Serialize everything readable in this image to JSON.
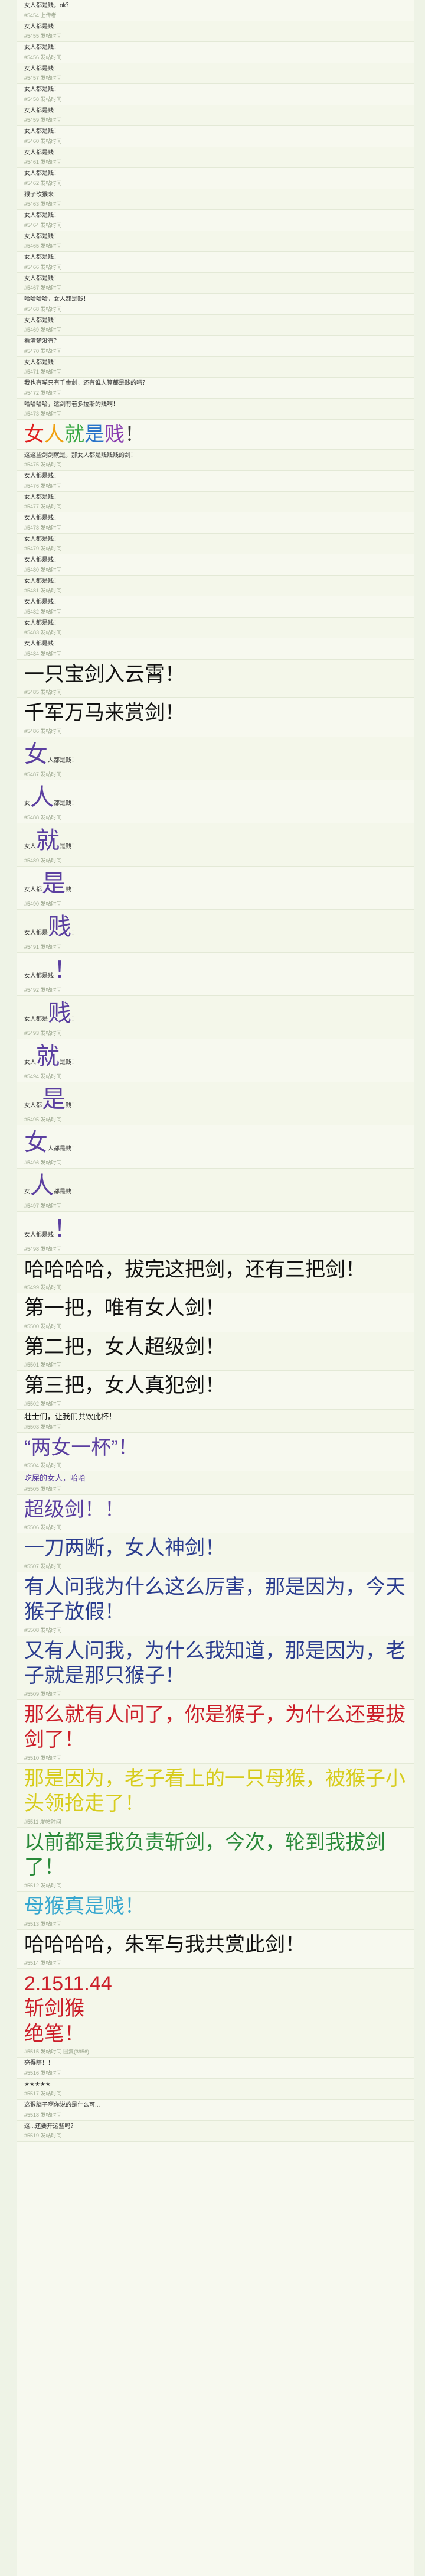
{
  "posts": [
    {
      "text": "女人都是贱，ok？",
      "size": "s1",
      "color": "",
      "meta": "#5454 上传者"
    },
    {
      "text": "女人都是贱！",
      "size": "s1",
      "color": "",
      "meta": "#5455 发帖时间"
    },
    {
      "text": "女人都是贱！",
      "size": "s1",
      "color": "",
      "meta": "#5456 发帖时间"
    },
    {
      "text": "女人都是贱！",
      "size": "s1",
      "color": "",
      "meta": "#5457 发帖时间"
    },
    {
      "text": "女人都是贱！",
      "size": "s1",
      "color": "",
      "meta": "#5458 发帖时间"
    },
    {
      "text": "女人都是贱！",
      "size": "s1",
      "color": "",
      "meta": "#5459 发帖时间"
    },
    {
      "text": "女人都是贱！",
      "size": "s1",
      "color": "",
      "meta": "#5460 发帖时间"
    },
    {
      "text": "女人都是贱！",
      "size": "s1",
      "color": "",
      "meta": "#5461 发帖时间"
    },
    {
      "text": "女人都是贱！",
      "size": "s1",
      "color": "",
      "meta": "#5462 发帖时间"
    },
    {
      "text": "猴子砍猴来！",
      "size": "s1",
      "color": "",
      "meta": "#5463 发帖时间"
    },
    {
      "text": "女人都是贱！",
      "size": "s1",
      "color": "",
      "meta": "#5464 发帖时间"
    },
    {
      "text": "女人都是贱！",
      "size": "s1",
      "color": "",
      "meta": "#5465 发帖时间"
    },
    {
      "text": "女人都是贱！",
      "size": "s1",
      "color": "",
      "meta": "#5466 发帖时间"
    },
    {
      "text": "女人都是贱！",
      "size": "s1",
      "color": "",
      "meta": "#5467 发帖时间"
    },
    {
      "text": "哈哈哈哈，女人都是贱！",
      "size": "s1",
      "color": "",
      "meta": "#5468 发帖时间"
    },
    {
      "text": "女人都是贱！",
      "size": "s1",
      "color": "",
      "meta": "#5469 发帖时间"
    },
    {
      "text": "看清楚没有？",
      "size": "s1",
      "color": "",
      "meta": "#5470 发帖时间"
    },
    {
      "text": "女人都是贱！",
      "size": "s1",
      "color": "",
      "meta": "#5471 发帖时间"
    },
    {
      "text": "我也有嘴只有千金剑，还有谁人算都是贱的吗？",
      "size": "s1",
      "color": "",
      "meta": "#5472 发帖时间"
    },
    {
      "text": "哈哈哈哈，这剑有着多拉斯的贱啊！",
      "size": "s1",
      "color": "",
      "meta": "#5473 发帖时间"
    },
    {
      "text": "女人就是贱！",
      "size": "big",
      "color": "rainbow",
      "meta": ""
    },
    {
      "text": "这这些剑剑就是，那女人都是贱贱贱的剑！",
      "size": "s1",
      "color": "",
      "meta": "#5475 发帖时间"
    },
    {
      "text": "女人都是贱！",
      "size": "s1",
      "color": "",
      "meta": "#5476 发帖时间"
    },
    {
      "text": "女人都是贱！",
      "size": "s1",
      "color": "",
      "meta": "#5477 发帖时间"
    },
    {
      "text": "女人都是贱！",
      "size": "s1",
      "color": "",
      "meta": "#5478 发帖时间"
    },
    {
      "text": "女人都是贱！",
      "size": "s1",
      "color": "",
      "meta": "#5479 发帖时间"
    },
    {
      "text": "女人都是贱！",
      "size": "s1",
      "color": "",
      "meta": "#5480 发帖时间"
    },
    {
      "text": "女人都是贱！",
      "size": "s1",
      "color": "",
      "meta": "#5481 发帖时间"
    },
    {
      "text": "女人都是贱！",
      "size": "s1",
      "color": "",
      "meta": "#5482 发帖时间"
    },
    {
      "text": "女人都是贱！",
      "size": "s1",
      "color": "",
      "meta": "#5483 发帖时间"
    },
    {
      "text": "女人都是贱！",
      "size": "s1",
      "color": "",
      "meta": "#5484 发帖时间"
    },
    {
      "text": "一只宝剑入云霄！",
      "size": "big",
      "color": "c-dark",
      "meta": "#5485 发帖时间"
    },
    {
      "text": "千军万马来赏剑！",
      "size": "big",
      "color": "c-dark",
      "meta": "#5486 发帖时间"
    },
    {
      "text": "女",
      "size": "huge",
      "color": "c-purple",
      "suffix": "人都是贱！",
      "meta": "#5487 发帖时间"
    },
    {
      "text": "人",
      "size": "huge",
      "color": "c-purple",
      "prefix": "女",
      "suffix": "都是贱！",
      "meta": "#5488 发帖时间"
    },
    {
      "text": "就",
      "size": "huge",
      "color": "c-purple",
      "prefix": "女人",
      "suffix": "是贱！",
      "meta": "#5489 发帖时间"
    },
    {
      "text": "是",
      "size": "huge",
      "color": "c-purple",
      "prefix": "女人都",
      "suffix": "贱！",
      "meta": "#5490 发帖时间"
    },
    {
      "text": "贱",
      "size": "huge",
      "color": "c-purple",
      "prefix": "女人都是",
      "suffix": "！",
      "meta": "#5491 发帖时间"
    },
    {
      "text": "！",
      "size": "huge",
      "color": "c-purple",
      "prefix": "女人都是贱",
      "suffix": "",
      "meta": "#5492 发帖时间"
    },
    {
      "text": "贱",
      "size": "huge",
      "color": "c-purple",
      "prefix": "女人都是",
      "suffix": "！",
      "meta": "#5493 发帖时间"
    },
    {
      "text": "就",
      "size": "huge",
      "color": "c-purple",
      "prefix": "女人",
      "suffix": "是贱！",
      "meta": "#5494 发帖时间"
    },
    {
      "text": "是",
      "size": "huge",
      "color": "c-purple",
      "prefix": "女人都",
      "suffix": "贱！",
      "meta": "#5495 发帖时间"
    },
    {
      "text": "女",
      "size": "huge",
      "color": "c-purple",
      "suffix": "人都是贱！",
      "meta": "#5496 发帖时间"
    },
    {
      "text": "人",
      "size": "huge",
      "color": "c-purple",
      "prefix": "女",
      "suffix": "都是贱！",
      "meta": "#5497 发帖时间"
    },
    {
      "text": "！",
      "size": "huge",
      "color": "c-purple",
      "prefix": "女人都是贱",
      "suffix": "",
      "meta": "#5498 发帖时间"
    },
    {
      "text": "哈哈哈哈，拔完这把剑，还有三把剑！",
      "size": "big",
      "color": "c-dark",
      "meta": "#5499 发帖时间"
    },
    {
      "text": "第一把，唯有女人剑！",
      "size": "big",
      "color": "c-dark",
      "meta": "#5500 发帖时间"
    },
    {
      "text": "第二把，女人超级剑！",
      "size": "big",
      "color": "c-dark",
      "meta": "#5501 发帖时间"
    },
    {
      "text": "第三把，女人真犯剑！",
      "size": "big",
      "color": "c-dark",
      "meta": "#5502 发帖时间"
    },
    {
      "text": "壮士们，让我们共饮此杯！",
      "size": "s2",
      "color": "c-dark",
      "meta": "#5503 发帖时间"
    },
    {
      "text": "“两女一杯”！",
      "size": "big",
      "color": "c-purple",
      "meta": "#5504 发帖时间"
    },
    {
      "text": "吃屎的女人，哈哈",
      "size": "s2",
      "color": "c-purple",
      "meta": "#5505 发帖时间"
    },
    {
      "text": "超级剑！！",
      "size": "big",
      "color": "c-purple",
      "meta": "#5506 发帖时间"
    },
    {
      "text": "一刀两断，女人神剑！",
      "size": "big",
      "color": "c-navy",
      "meta": "#5507 发帖时间"
    },
    {
      "text": "有人问我为什么这么厉害，那是因为，今天猴子放假！",
      "size": "big",
      "color": "c-navy",
      "meta": "#5508 发帖时间"
    },
    {
      "text": "又有人问我，为什么我知道，那是因为，老子就是那只猴子！",
      "size": "big",
      "color": "c-navy",
      "meta": "#5509 发帖时间"
    },
    {
      "text": "那么就有人问了，你是猴子，为什么还要拔剑了！",
      "size": "big",
      "color": "c-red",
      "meta": "#5510 发帖时间"
    },
    {
      "text": "那是因为，老子看上的一只母猴，被猴子小头领抢走了！",
      "size": "big",
      "color": "c-yellow",
      "meta": "#5511 发帖时间"
    },
    {
      "text": "以前都是我负责斩剑，今次，轮到我拔剑了！",
      "size": "big",
      "color": "c-green",
      "meta": "#5512 发帖时间"
    },
    {
      "text": "母猴真是贱！",
      "size": "big",
      "color": "c-cyan",
      "meta": "#5513 发帖时间"
    },
    {
      "text": "哈哈哈哈，朱军与我共赏此剑！",
      "size": "big",
      "color": "c-dark",
      "meta": "#5514 发帖时间"
    },
    {
      "text": "2.1511.44\n斩剑猴\n绝笔！",
      "size": "big",
      "color": "c-red",
      "meta": "#5515 发帖时间 回复(3956)"
    },
    {
      "text": "亮得瞎！！",
      "size": "s1",
      "color": "",
      "meta": "#5516 发帖时间"
    },
    {
      "text": "★★★★★",
      "size": "s1",
      "color": "",
      "meta": "#5517 发帖时间"
    },
    {
      "text": "这猴脑子啊你说的是什么可...",
      "size": "s1",
      "color": "",
      "meta": "#5518 发帖时间"
    },
    {
      "text": "这...还要开这些吗？",
      "size": "s1",
      "color": "",
      "meta": "#5519 发帖时间"
    }
  ]
}
